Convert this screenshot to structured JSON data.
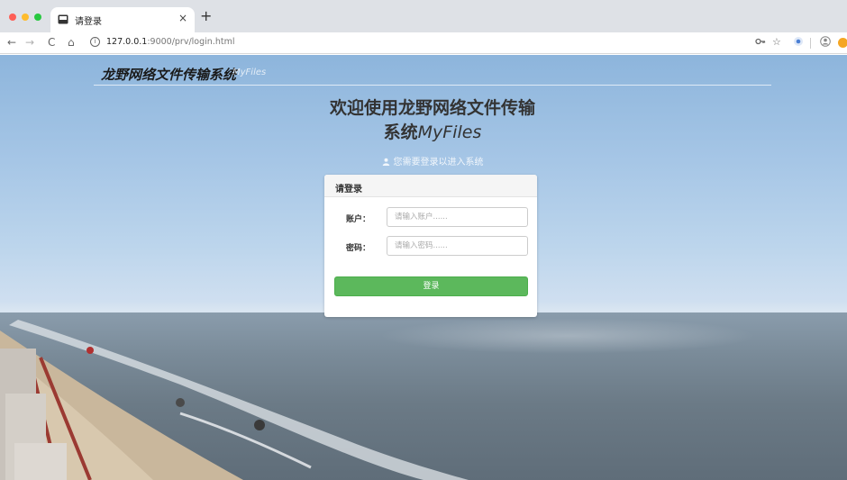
{
  "browser": {
    "tab_title": "请登录",
    "tab_close": "×",
    "new_tab": "+",
    "url_host": "127.0.0.1",
    "url_rest": ":9000/prv/login.html",
    "nav": {
      "back": "←",
      "forward": "→",
      "reload": "C",
      "home": "⌂"
    },
    "info_icon": "i",
    "icons": [
      "key-icon",
      "star-icon",
      "extension-icon",
      "avatar-icon",
      "orange-extension-icon"
    ],
    "star_glyph": "☆"
  },
  "header": {
    "brand": "龙野网络文件传输系统",
    "brand_sub": "MyFiles"
  },
  "welcome": {
    "line1": "欢迎使用龙野网络文件传输",
    "line2_cn": "系统",
    "line2_en": "MyFiles",
    "hint": "您需要登录以进入系统"
  },
  "login": {
    "panel_title": "请登录",
    "account_label": "账户：",
    "account_placeholder": "请输入账户......",
    "password_label": "密码：",
    "password_placeholder": "请输入密码......",
    "submit_label": "登录"
  },
  "colors": {
    "button": "#5cb85c",
    "sky": "#a6c6e6",
    "sea": "#6b7a86"
  }
}
